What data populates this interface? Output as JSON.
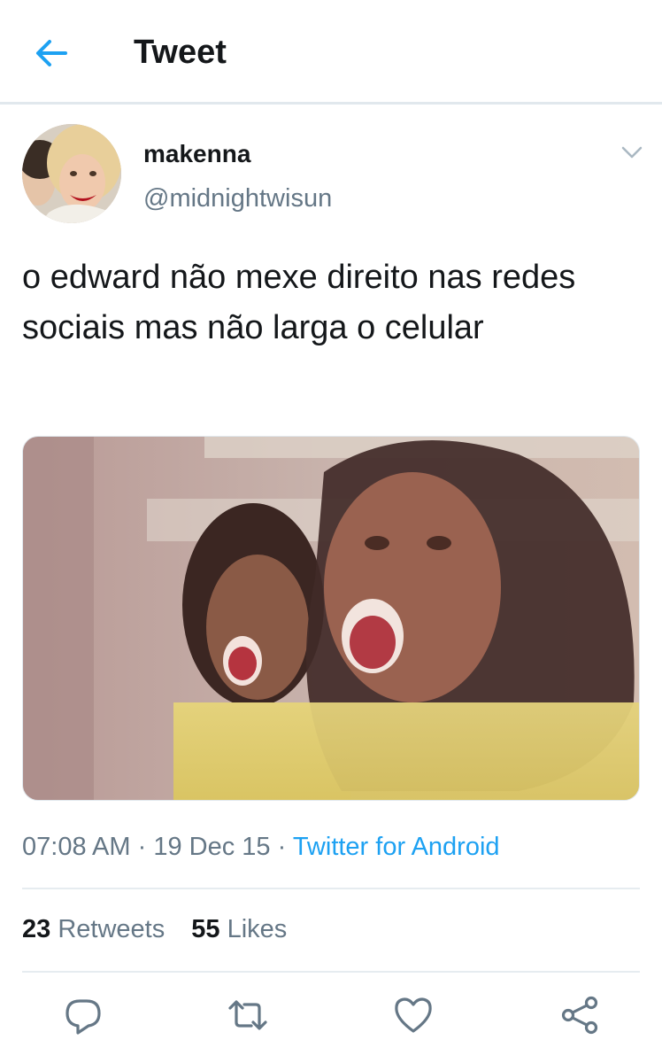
{
  "header": {
    "title": "Tweet",
    "back_icon": "arrow-left-icon",
    "accent": "#1da1f2"
  },
  "author": {
    "name": "makenna",
    "handle": "@midnightwisun",
    "avatar_icon": "avatar"
  },
  "tweet": {
    "text": "o edward não mexe direito nas redes sociais mas não larga o celular",
    "time": "07:08 AM",
    "date": "19 Dec 15",
    "dot": "·",
    "source": "Twitter for Android"
  },
  "stats": {
    "retweets_count": "23",
    "retweets_label": "Retweets",
    "likes_count": "55",
    "likes_label": "Likes"
  },
  "actions": [
    "reply-icon",
    "retweet-icon",
    "like-icon",
    "share-icon"
  ],
  "colors": {
    "text": "#14171a",
    "secondary": "#657786",
    "divider": "#e6ecf0",
    "link": "#1da1f2"
  }
}
